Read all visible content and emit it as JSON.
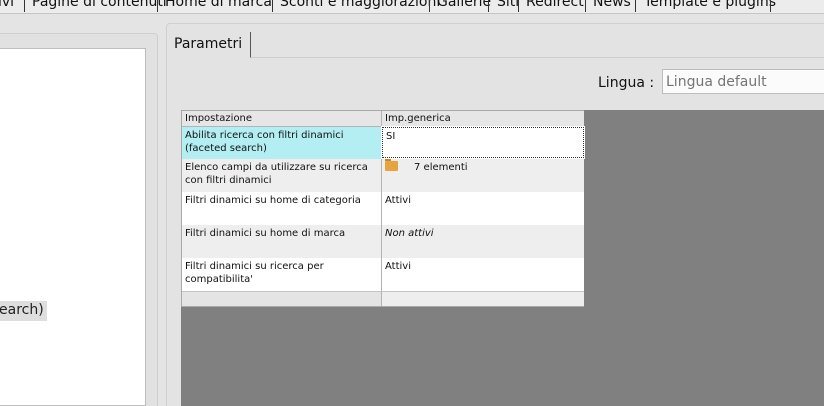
{
  "menu": {
    "items": [
      "ivi",
      "Pagine di contenuti",
      "Home di marca",
      "Sconti e maggiorazioni",
      "Gallerie",
      "Siti",
      "Redirect",
      "News",
      "Template e plugins"
    ]
  },
  "left_panel": {
    "fragment_text": "earch)"
  },
  "tabs": {
    "active_label": "Parametri"
  },
  "lingua": {
    "label": "Lingua :",
    "placeholder": "Lingua default"
  },
  "grid": {
    "headers": [
      "Impostazione",
      "Imp.generica"
    ],
    "rows": [
      {
        "setting": "Abilita ricerca con filtri dinamici (faceted search)",
        "value": "SI"
      },
      {
        "setting": "Elenco campi da utilizzare su ricerca con filtri dinamici",
        "value": "7 elementi",
        "icon": "folder-icon"
      },
      {
        "setting": "Filtri dinamici su home di categoria",
        "value": "Attivi"
      },
      {
        "setting": "Filtri dinamici su home di marca",
        "value": "Non attivi"
      },
      {
        "setting": "Filtri dinamici su ricerca per compatibilita'",
        "value": "Attivi"
      }
    ]
  },
  "colors": {
    "selected_row": "#b3eef3",
    "grid_background": "#808080",
    "alt_row": "#eeeeee"
  }
}
